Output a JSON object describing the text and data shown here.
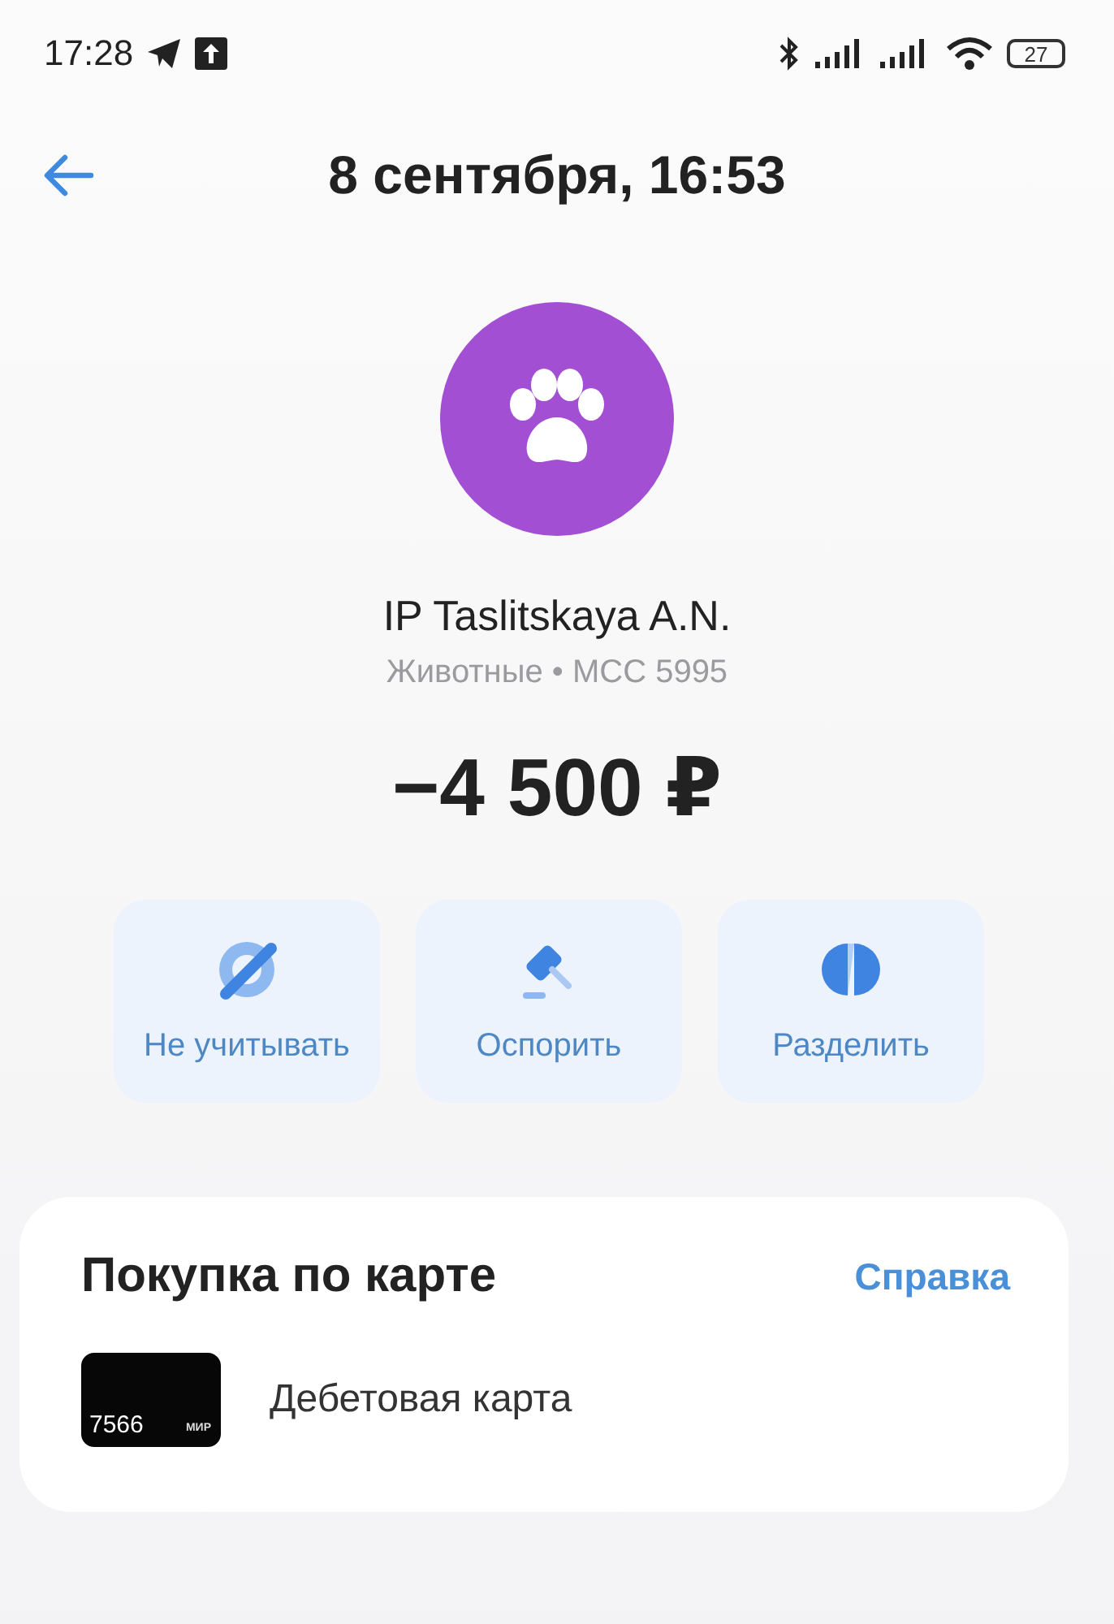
{
  "status_bar": {
    "time": "17:28",
    "battery": "27"
  },
  "header": {
    "title": "8 сентября, 16:53"
  },
  "merchant": {
    "name": "IP Taslitskaya A.N.",
    "category": "Животные • MCC 5995",
    "amount": "−4 500 ₽"
  },
  "actions": [
    {
      "kind": "exclude",
      "label": "Не учитывать"
    },
    {
      "kind": "dispute",
      "label": "Оспорить"
    },
    {
      "kind": "split",
      "label": "Разделить"
    }
  ],
  "details": {
    "title": "Покупка по карте",
    "help_link": "Справка",
    "card": {
      "number": "7566",
      "brand": "МИР",
      "name": "Дебетовая карта"
    }
  }
}
